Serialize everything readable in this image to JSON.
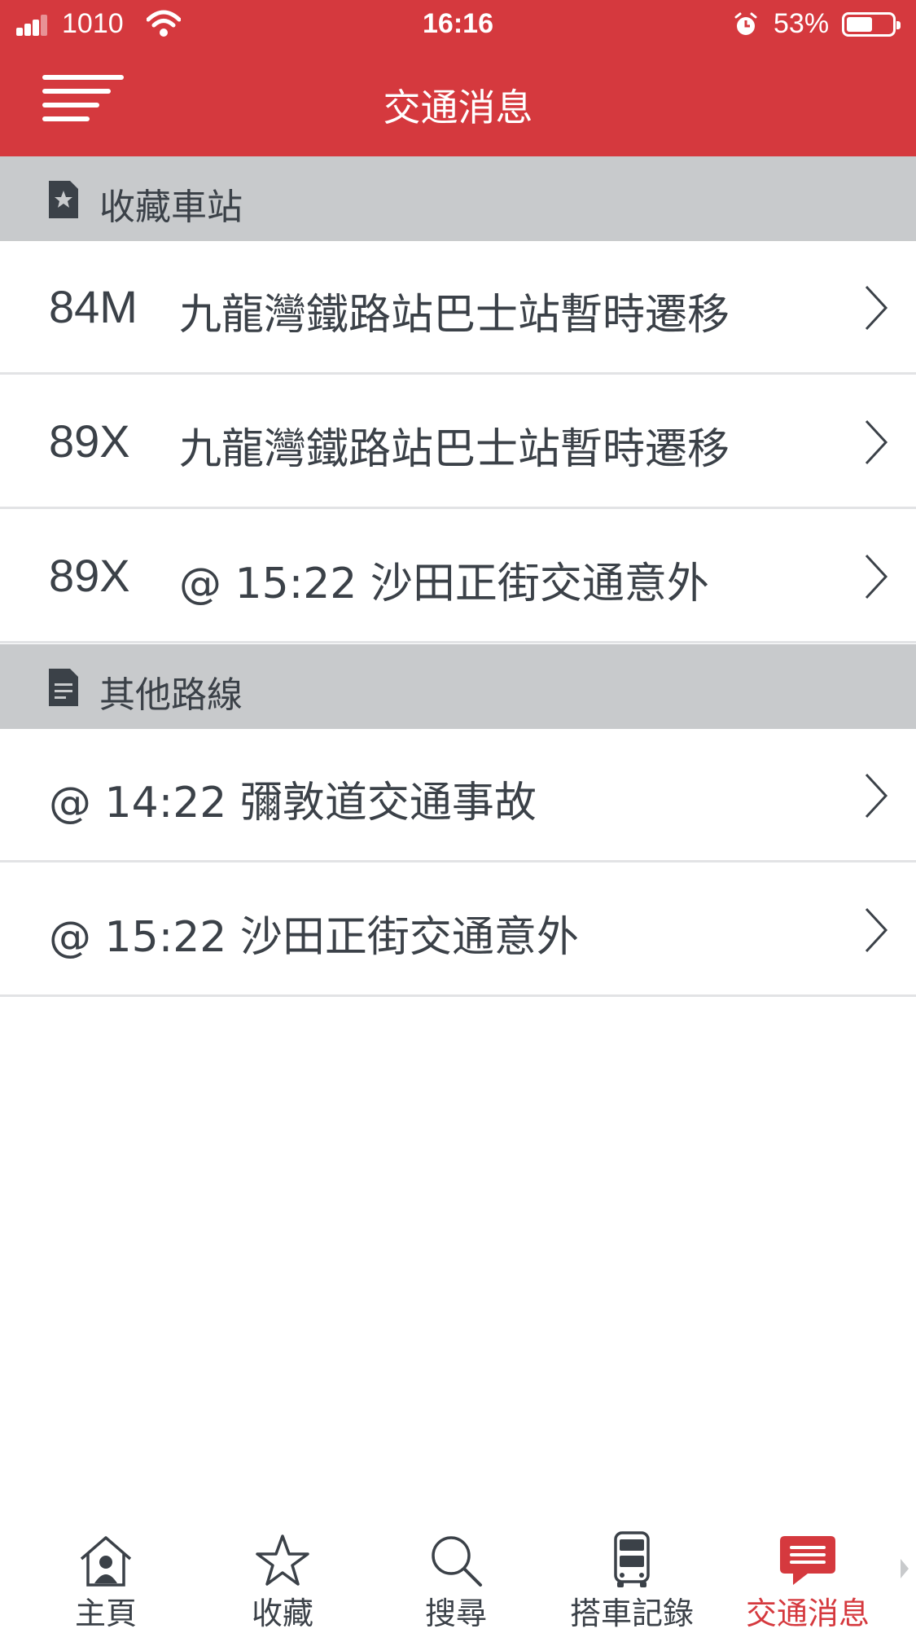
{
  "status_bar": {
    "carrier": "1010",
    "time": "16:16",
    "battery_percent": "53%",
    "battery_level": 0.53
  },
  "header": {
    "title": "交通消息",
    "menu_icon": "hamburger-menu-icon",
    "background_color": "#d5393e"
  },
  "sections": {
    "favorites": {
      "title": "收藏車站",
      "icon": "bookmark-star-icon",
      "items": [
        {
          "route": "84M",
          "message": "九龍灣鐵路站巴士站暫時遷移"
        },
        {
          "route": "89X",
          "message": "九龍灣鐵路站巴士站暫時遷移"
        },
        {
          "route": "89X",
          "message": "@ 15:22 沙田正街交通意外"
        }
      ]
    },
    "others": {
      "title": "其他路線",
      "icon": "document-icon",
      "items": [
        {
          "message": "@ 14:22 彌敦道交通事故"
        },
        {
          "message": "@ 15:22 沙田正街交通意外"
        }
      ]
    }
  },
  "tabs": [
    {
      "label": "主頁",
      "icon": "home-icon",
      "active": false
    },
    {
      "label": "收藏",
      "icon": "star-icon",
      "active": false
    },
    {
      "label": "搜尋",
      "icon": "search-icon",
      "active": false
    },
    {
      "label": "搭車記錄",
      "icon": "bus-icon",
      "active": false
    },
    {
      "label": "交通消息",
      "icon": "message-icon",
      "active": true
    }
  ],
  "colors": {
    "accent": "#d5393e",
    "section_header_bg": "#c8cacc",
    "text": "#3b4148",
    "divider": "#e2e3e5"
  }
}
